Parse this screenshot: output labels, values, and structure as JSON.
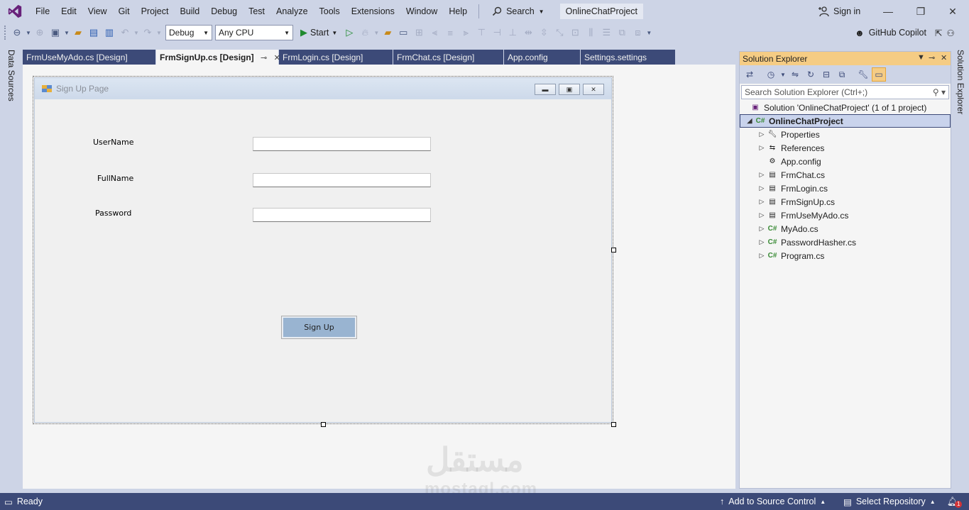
{
  "menubar": {
    "items": [
      "File",
      "Edit",
      "View",
      "Git",
      "Project",
      "Build",
      "Debug",
      "Test",
      "Analyze",
      "Tools",
      "Extensions",
      "Window",
      "Help"
    ],
    "search_label": "Search",
    "project_title": "OnlineChatProject",
    "signin_label": "Sign in"
  },
  "toolbar": {
    "config": "Debug",
    "platform": "Any CPU",
    "start_label": "Start",
    "copilot_label": "GitHub Copilot"
  },
  "left_strip": {
    "data_sources_label": "Data Sources"
  },
  "right_strip": {
    "solution_explorer_label": "Solution Explorer"
  },
  "doc_tabs": [
    {
      "label": "FrmUseMyAdo.cs [Design]"
    },
    {
      "label": "FrmSignUp.cs [Design]"
    },
    {
      "label": "FrmLogin.cs [Design]"
    },
    {
      "label": "FrmChat.cs [Design]"
    },
    {
      "label": "App.config"
    },
    {
      "label": "Settings.settings"
    }
  ],
  "form": {
    "title": "Sign Up Page",
    "labels": {
      "username": "UserName",
      "fullname": "FullName",
      "password": "Password"
    },
    "inputs": {
      "username": "",
      "fullname": "",
      "password": ""
    },
    "button_label": "Sign Up"
  },
  "watermark": {
    "arabic": "مستقل",
    "latin": "mostaql.com"
  },
  "solution_explorer": {
    "title": "Solution Explorer",
    "search_placeholder": "Search Solution Explorer (Ctrl+;)",
    "solution_label": "Solution 'OnlineChatProject' (1 of 1 project)",
    "project_label": "OnlineChatProject",
    "items": [
      {
        "label": "Properties",
        "icon": "wrench-icon",
        "expandable": true
      },
      {
        "label": "References",
        "icon": "references-icon",
        "expandable": true
      },
      {
        "label": "App.config",
        "icon": "config-file-icon",
        "expandable": false
      },
      {
        "label": "FrmChat.cs",
        "icon": "form-icon",
        "expandable": true
      },
      {
        "label": "FrmLogin.cs",
        "icon": "form-icon",
        "expandable": true
      },
      {
        "label": "FrmSignUp.cs",
        "icon": "form-icon",
        "expandable": true
      },
      {
        "label": "FrmUseMyAdo.cs",
        "icon": "form-icon",
        "expandable": true
      },
      {
        "label": "MyAdo.cs",
        "icon": "csharp-file-icon",
        "expandable": true
      },
      {
        "label": "PasswordHasher.cs",
        "icon": "csharp-file-icon",
        "expandable": true
      },
      {
        "label": "Program.cs",
        "icon": "csharp-file-icon",
        "expandable": true
      }
    ]
  },
  "statusbar": {
    "ready": "Ready",
    "source_control": "Add to Source Control",
    "repository": "Select Repository",
    "notification_count": "1"
  },
  "colors": {
    "chrome": "#cdd4e6",
    "accent_dark": "#3c4a78",
    "active_panel": "#f5cc84",
    "button_face": "#99b4d1"
  }
}
